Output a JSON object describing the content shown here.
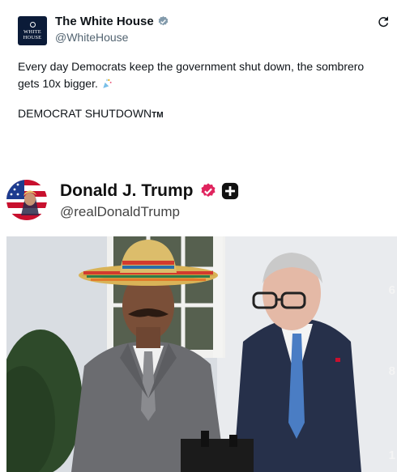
{
  "whitehouse_post": {
    "avatar_text_top": "WHITE",
    "avatar_text_bottom": "HOUSE",
    "name": "The White House",
    "handle": "@WhiteHouse",
    "text_line": "Every day Democrats keep the government shut down, the sombrero gets 10x bigger.",
    "text_shutdown": "DEMOCRAT SHUTDOWN",
    "text_tm": "TM"
  },
  "embedded_post": {
    "name": "Donald J. Trump",
    "handle": "@realDonaldTrump"
  },
  "video": {
    "side_digits": [
      "6",
      "8",
      "1"
    ]
  },
  "colors": {
    "verified_grey": "#829aab",
    "verified_red": "#e0245e",
    "plus_black": "#111111",
    "wh_navy": "#0b1b38"
  }
}
